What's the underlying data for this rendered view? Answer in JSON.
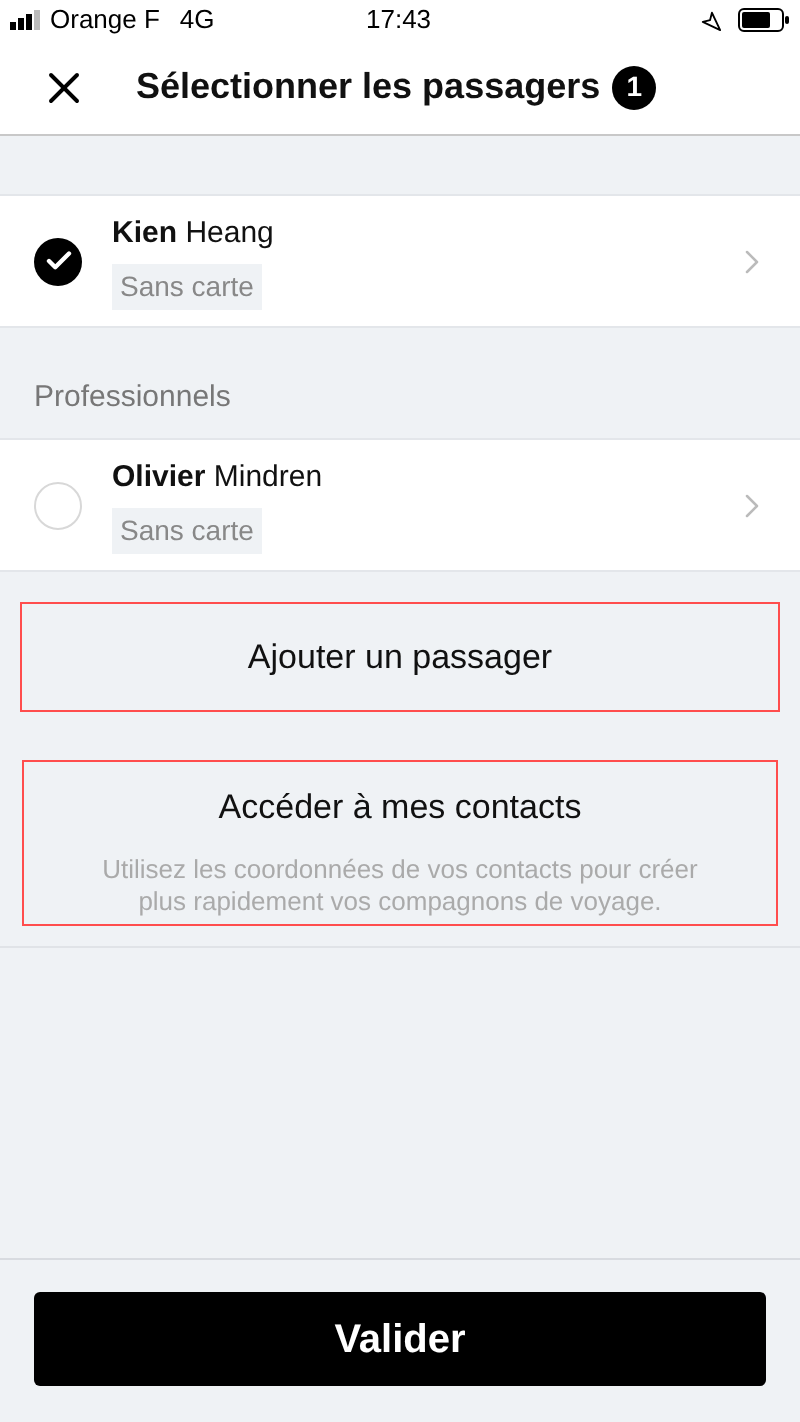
{
  "status_bar": {
    "carrier": "Orange F",
    "network": "4G",
    "time": "17:43"
  },
  "header": {
    "title": "Sélectionner les passagers",
    "badge": "1"
  },
  "groups": [
    {
      "passengers": [
        {
          "first_name": "Kien",
          "last_name": "Heang",
          "tag": "Sans carte",
          "selected": true
        }
      ]
    },
    {
      "heading": "Professionnels",
      "passengers": [
        {
          "first_name": "Olivier",
          "last_name": "Mindren",
          "tag": "Sans carte",
          "selected": false
        }
      ]
    }
  ],
  "add_passenger": {
    "label": "Ajouter un passager"
  },
  "contacts": {
    "label": "Accéder à mes contacts",
    "description": "Utilisez les coordonnées de vos contacts pour créer plus rapidement vos compagnons de voyage."
  },
  "submit": {
    "label": "Valider"
  }
}
